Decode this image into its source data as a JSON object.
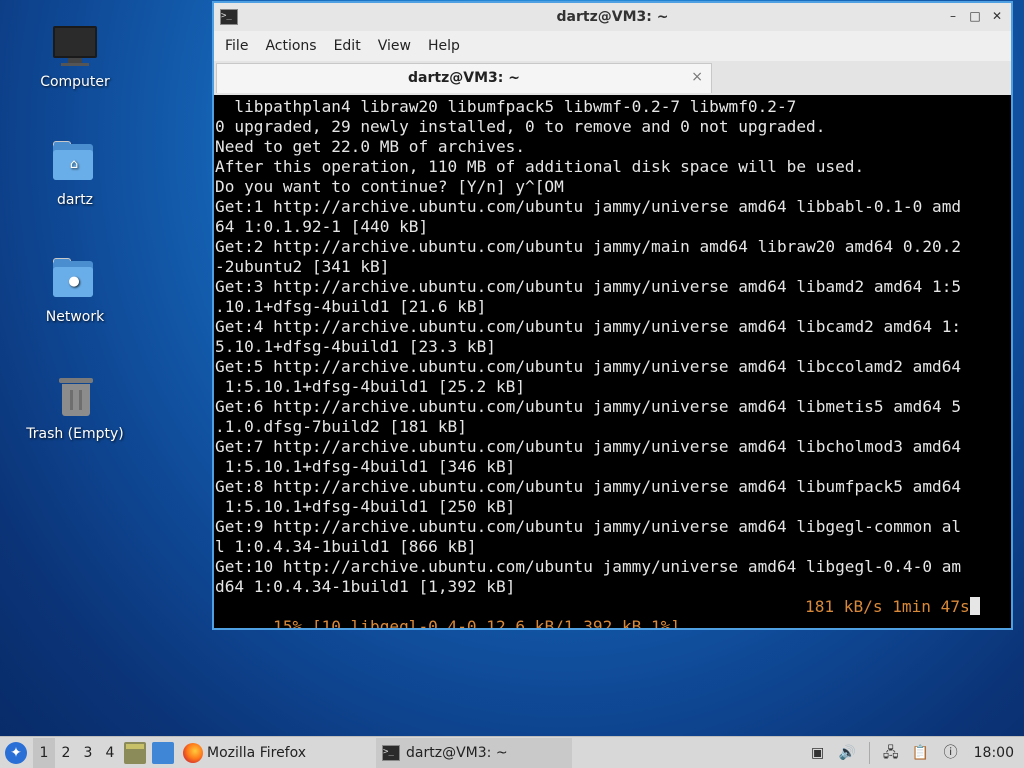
{
  "desktop": {
    "icons": [
      {
        "label": "Computer",
        "icon": "computer-icon"
      },
      {
        "label": "dartz",
        "icon": "home-folder-icon"
      },
      {
        "label": "Network",
        "icon": "network-folder-icon"
      },
      {
        "label": "Trash (Empty)",
        "icon": "trash-icon"
      }
    ]
  },
  "window": {
    "title": "dartz@VM3: ~",
    "menu": [
      "File",
      "Actions",
      "Edit",
      "View",
      "Help"
    ],
    "tab_label": "dartz@VM3: ~",
    "tab_close": "×",
    "controls": {
      "minimize": "–",
      "maximize": "□",
      "close": "✕"
    }
  },
  "terminal": {
    "lines": [
      "  libpathplan4 libraw20 libumfpack5 libwmf-0.2-7 libwmf0.2-7",
      "0 upgraded, 29 newly installed, 0 to remove and 0 not upgraded.",
      "Need to get 22.0 MB of archives.",
      "After this operation, 110 MB of additional disk space will be used.",
      "Do you want to continue? [Y/n] y^[OM",
      "Get:1 http://archive.ubuntu.com/ubuntu jammy/universe amd64 libbabl-0.1-0 amd",
      "64 1:0.1.92-1 [440 kB]",
      "Get:2 http://archive.ubuntu.com/ubuntu jammy/main amd64 libraw20 amd64 0.20.2",
      "-2ubuntu2 [341 kB]",
      "Get:3 http://archive.ubuntu.com/ubuntu jammy/universe amd64 libamd2 amd64 1:5",
      ".10.1+dfsg-4build1 [21.6 kB]",
      "Get:4 http://archive.ubuntu.com/ubuntu jammy/universe amd64 libcamd2 amd64 1:",
      "5.10.1+dfsg-4build1 [23.3 kB]",
      "Get:5 http://archive.ubuntu.com/ubuntu jammy/universe amd64 libccolamd2 amd64",
      " 1:5.10.1+dfsg-4build1 [25.2 kB]",
      "Get:6 http://archive.ubuntu.com/ubuntu jammy/universe amd64 libmetis5 amd64 5",
      ".1.0.dfsg-7build2 [181 kB]",
      "Get:7 http://archive.ubuntu.com/ubuntu jammy/universe amd64 libcholmod3 amd64",
      " 1:5.10.1+dfsg-4build1 [346 kB]",
      "Get:8 http://archive.ubuntu.com/ubuntu jammy/universe amd64 libumfpack5 amd64",
      " 1:5.10.1+dfsg-4build1 [250 kB]",
      "Get:9 http://archive.ubuntu.com/ubuntu jammy/universe amd64 libgegl-common al",
      "l 1:0.4.34-1build1 [866 kB]",
      "Get:10 http://archive.ubuntu.com/ubuntu jammy/universe amd64 libgegl-0.4-0 am",
      "d64 1:0.4.34-1build1 [1,392 kB]"
    ],
    "progress_left": "15% [10 libgegl-0.4-0 12.6 kB/1,392 kB 1%]",
    "progress_right": "181 kB/s 1min 47s"
  },
  "taskbar": {
    "workspaces": [
      "1",
      "2",
      "3",
      "4"
    ],
    "firefox_label": "Mozilla Firefox",
    "terminal_label": "dartz@VM3: ~",
    "clock": "18:00"
  }
}
